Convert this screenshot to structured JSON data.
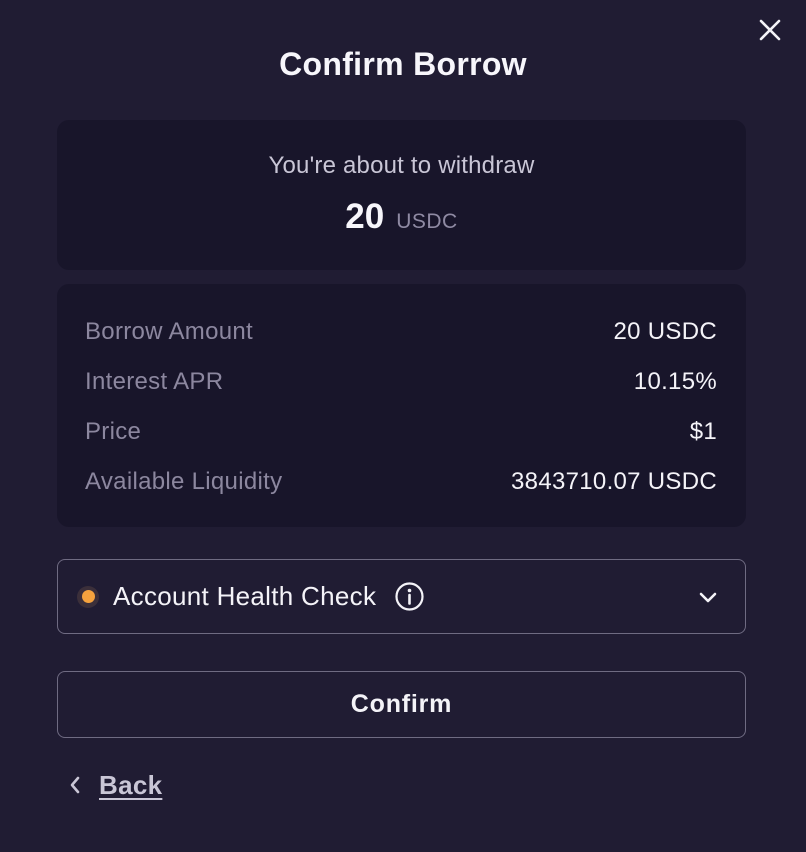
{
  "modal": {
    "title": "Confirm Borrow",
    "close_icon": "close-icon"
  },
  "summary": {
    "label": "You're about to withdraw",
    "amount": "20",
    "unit": "USDC"
  },
  "details": [
    {
      "label": "Borrow Amount",
      "value": "20 USDC"
    },
    {
      "label": "Interest APR",
      "value": "10.15%"
    },
    {
      "label": "Price",
      "value": "$1"
    },
    {
      "label": "Available Liquidity",
      "value": "3843710.07 USDC"
    }
  ],
  "health_check": {
    "label": "Account Health Check",
    "status_color": "#f5a23e",
    "info_icon": "info-icon",
    "expand_icon": "chevron-down-icon"
  },
  "actions": {
    "confirm_label": "Confirm",
    "back_label": "Back",
    "back_icon": "chevron-left-icon"
  },
  "colors": {
    "background": "#201c33",
    "card": "#18152a",
    "border": "#6f6b82",
    "warning": "#f5a23e"
  }
}
